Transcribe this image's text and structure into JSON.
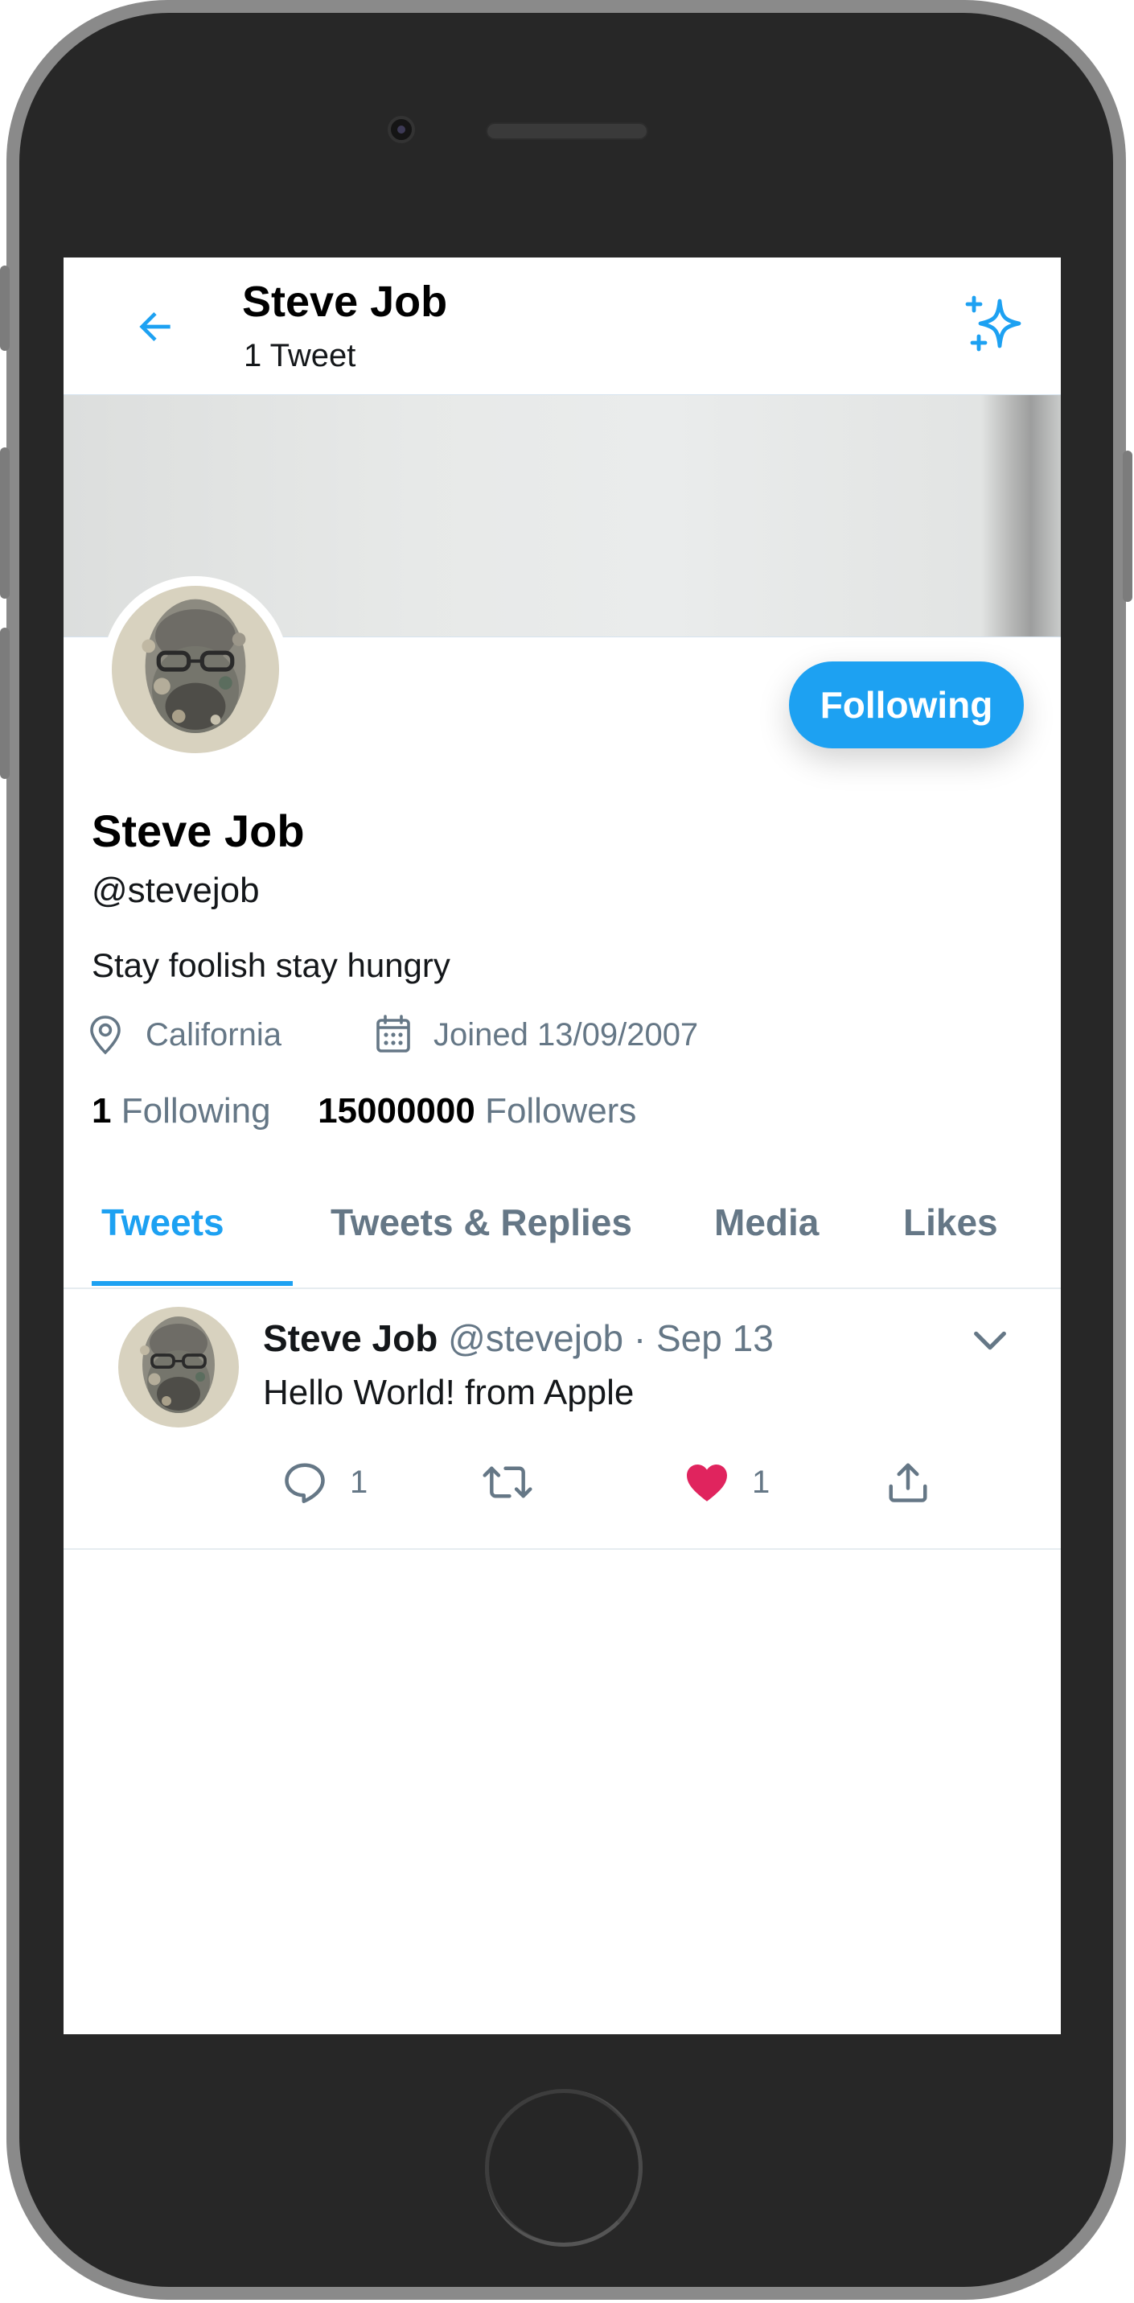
{
  "header": {
    "title": "Steve Job",
    "subtitle": "1 Tweet"
  },
  "profile": {
    "name": "Steve Job",
    "handle": "@stevejob",
    "bio": "Stay foolish stay hungry",
    "location": "California",
    "joined": "Joined 13/09/2007",
    "following_count": "1",
    "following_label": "Following",
    "followers_count": "15000000",
    "followers_label": "Followers",
    "follow_button": "Following"
  },
  "tabs": [
    {
      "label": "Tweets",
      "active": true
    },
    {
      "label": "Tweets & Replies",
      "active": false
    },
    {
      "label": "Media",
      "active": false
    },
    {
      "label": "Likes",
      "active": false
    }
  ],
  "tweet": {
    "author": "Steve Job",
    "handle": "@stevejob",
    "date": "· Sep 13",
    "text": "Hello World! from Apple",
    "replies": "1",
    "likes": "1"
  },
  "colors": {
    "accent": "#1da1f2",
    "secondary_text": "#657786",
    "like": "#e0245e"
  },
  "icons": [
    "back-arrow-icon",
    "sparkle-icon",
    "location-pin-icon",
    "calendar-icon",
    "chevron-down-icon",
    "reply-icon",
    "retweet-icon",
    "heart-icon",
    "share-icon"
  ]
}
